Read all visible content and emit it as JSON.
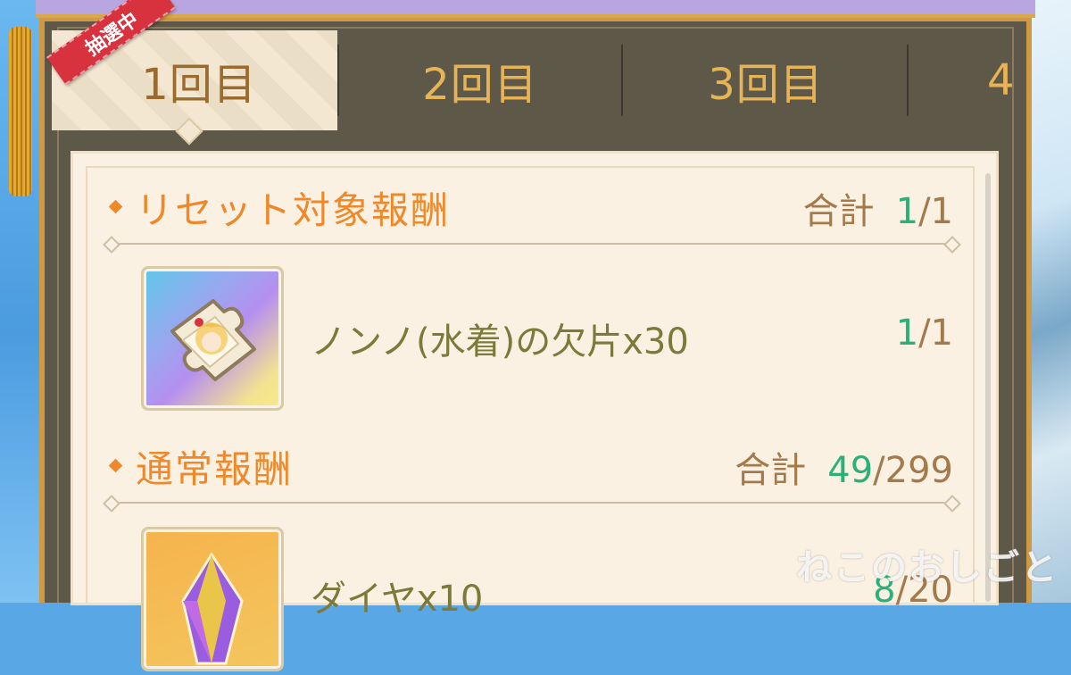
{
  "tabs": [
    {
      "label": "1回目",
      "active": true
    },
    {
      "label": "2回目",
      "active": false
    },
    {
      "label": "3回目",
      "active": false
    },
    {
      "label": "4",
      "active": false
    }
  ],
  "active_ribbon": "抽選中",
  "sections": [
    {
      "title": "リセット対象報酬",
      "total_label": "合計",
      "total_current": "1",
      "total_max": "/1",
      "items": [
        {
          "name": "ノンノ(水着)の欠片x30",
          "current": "1",
          "max": "/1",
          "icon": "puzzle-piece-icon"
        }
      ]
    },
    {
      "title": "通常報酬",
      "total_label": "合計",
      "total_current": "49",
      "total_max": "/299",
      "items": [
        {
          "name": "ダイヤx10",
          "current": "8",
          "max": "/20",
          "icon": "diamond-icon"
        }
      ]
    }
  ],
  "watermark": "ねこのおしごと",
  "colors": {
    "accent_orange": "#f0882a",
    "count_green": "#2bb07a",
    "tab_gold": "#e6b457",
    "frame_gold": "#d09a44"
  }
}
